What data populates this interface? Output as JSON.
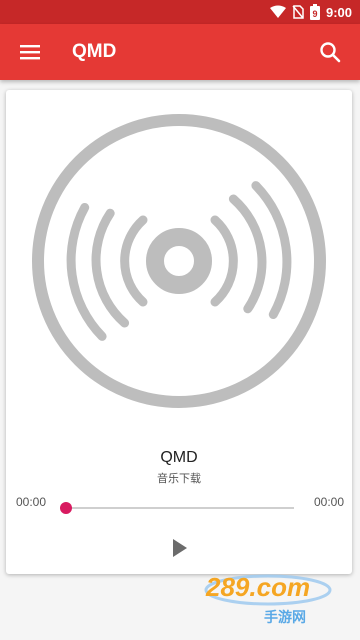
{
  "status_bar": {
    "time": "9:00",
    "battery_level": "9"
  },
  "app_bar": {
    "title": "QMD",
    "menu_icon": "menu-icon",
    "search_icon": "search-icon"
  },
  "player": {
    "song_title": "QMD",
    "artist": "音乐下载",
    "current_time": "00:00",
    "total_time": "00:00",
    "progress": 0,
    "play_icon": "play-icon"
  },
  "watermark": {
    "brand": "289.com",
    "subtitle": "手游网"
  },
  "colors": {
    "status_bar": "#c62828",
    "app_bar": "#e53935",
    "seek_thumb": "#d81b60",
    "disc": "#bdbdbd"
  }
}
